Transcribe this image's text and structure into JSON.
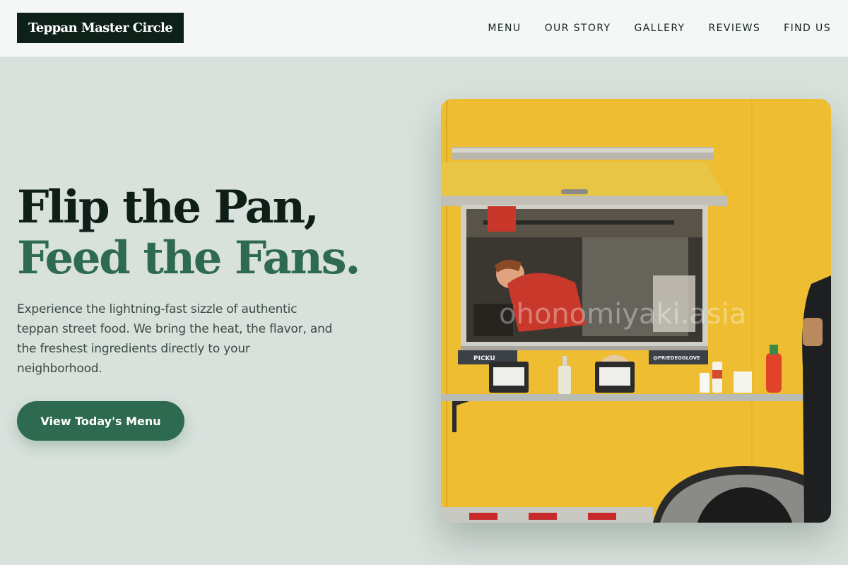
{
  "brand": {
    "name": "Teppan Master Circle"
  },
  "nav": {
    "items": [
      {
        "label": "MENU"
      },
      {
        "label": "OUR STORY"
      },
      {
        "label": "GALLERY"
      },
      {
        "label": "REVIEWS"
      },
      {
        "label": "FIND US"
      }
    ]
  },
  "hero": {
    "title_line1": "Flip the Pan,",
    "title_line2": "Feed the Fans.",
    "description": "Experience the lightning-fast sizzle of authentic teppan street food. We bring the heat, the flavor, and the freshest ingredients directly to your neighborhood.",
    "cta_label": "View Today's Menu"
  },
  "image": {
    "pickup_sign": "PICKU",
    "handle_sign": "@FRIEDEGGLOVE",
    "watermark": "ohonomiyaki.asia"
  },
  "colors": {
    "background": "#d8e1dc",
    "header_bg": "#f4f7f6",
    "logo_bg": "#0e2119",
    "accent_green": "#2d6a4f",
    "heading_dark": "#0f1e17",
    "truck_yellow": "#f0c034"
  }
}
